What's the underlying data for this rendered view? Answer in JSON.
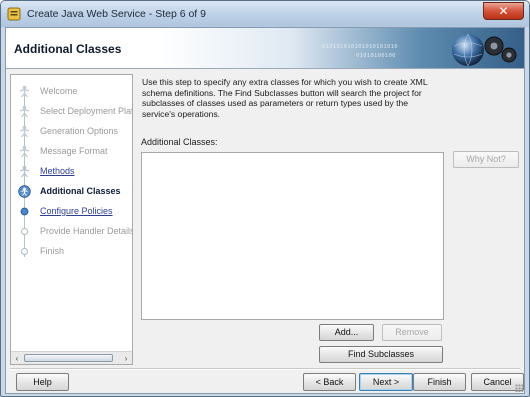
{
  "window": {
    "title": "Create Java Web Service - Step 6 of 9",
    "close_glyph": "✕"
  },
  "banner": {
    "title": "Additional Classes",
    "binary_line_1": "010101010101010101010",
    "binary_line_2": "01010100100"
  },
  "nav": {
    "items": [
      {
        "label": "Welcome",
        "state": "disabled"
      },
      {
        "label": "Select Deployment Platform",
        "state": "disabled"
      },
      {
        "label": "Generation Options",
        "state": "disabled"
      },
      {
        "label": "Message Format",
        "state": "disabled"
      },
      {
        "label": "Methods",
        "state": "link"
      },
      {
        "label": "Additional Classes",
        "state": "current"
      },
      {
        "label": "Configure Policies",
        "state": "link"
      },
      {
        "label": "Provide Handler Details",
        "state": "disabled"
      },
      {
        "label": "Finish",
        "state": "disabled"
      }
    ],
    "scroll_left": "‹",
    "scroll_right": "›"
  },
  "main": {
    "description": "Use this step to specify any extra classes for which you wish to create XML schema definitions. The Find Subclasses button will search the project for subclasses of classes used as parameters or return types used by the service's operations.",
    "classes_label": "Additional Classes:",
    "classes_items": []
  },
  "buttons": {
    "why_not": "Why Not?",
    "add": "Add...",
    "remove": "Remove",
    "find_subclasses": "Find Subclasses",
    "help": "Help",
    "back": "< Back",
    "next": "Next >",
    "finish": "Finish",
    "cancel": "Cancel"
  },
  "colors": {
    "link": "#2e3f8f",
    "disabled_text": "#9a9a9a",
    "current_text": "#0f1d3a",
    "close_red": "#d4533b",
    "titlebar": "#bcd0e6"
  }
}
